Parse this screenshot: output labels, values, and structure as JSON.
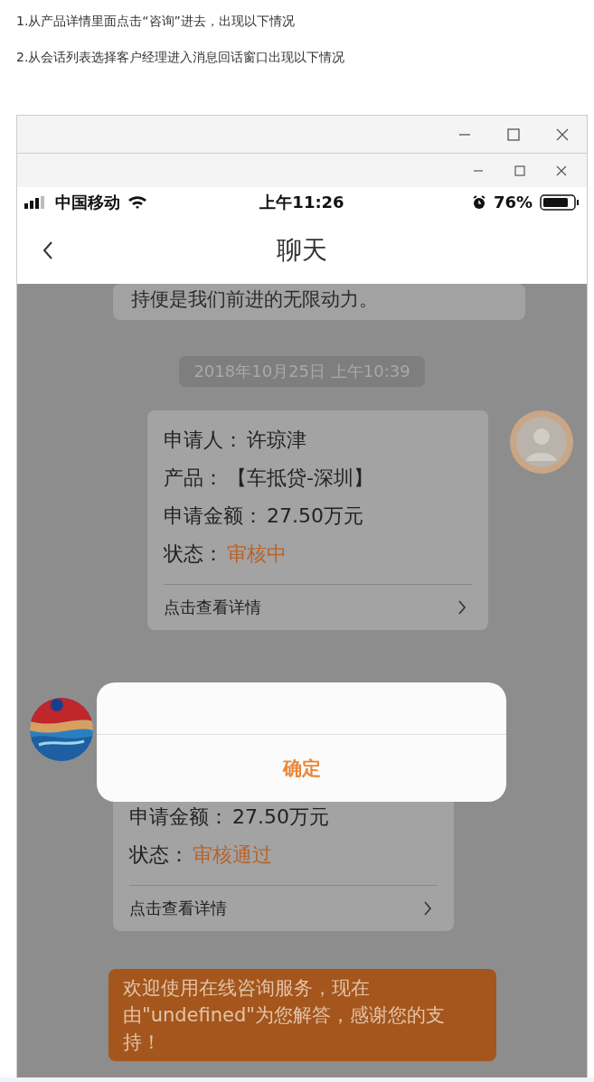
{
  "intro": [
    "1.从产品详情里面点击“咨询”进去，出现以下情况",
    "2.从会话列表选择客户经理进入消息回话窗口出现以下情况"
  ],
  "status_bar": {
    "carrier": "中国移动",
    "time": "上午11:26",
    "battery": "76%"
  },
  "nav": {
    "title": "聊天"
  },
  "messages": [
    {
      "kind": "note",
      "text": "持便是我们前进的无限动力。"
    },
    {
      "kind": "time",
      "text": "2018年10月25日 上午10:39"
    },
    {
      "kind": "sent",
      "rows": [
        {
          "label": "申请人：",
          "value": "许琼津",
          "kind": "plain"
        },
        {
          "label": "产品：",
          "value": "【车抵贷-深圳】",
          "kind": "plain"
        },
        {
          "label": "申请金额：",
          "value": "27.50万元",
          "kind": "plain"
        },
        {
          "label": "状态：",
          "value": "审核中",
          "kind": "status"
        }
      ],
      "link": "点击查看详情"
    },
    {
      "kind": "received",
      "rows": [
        {
          "label": "申请金额：",
          "value": "27.50万元",
          "kind": "plain"
        },
        {
          "label": "状态：",
          "value": "审核通过",
          "kind": "status"
        }
      ],
      "link": "点击查看详情"
    },
    {
      "kind": "bubble",
      "text": "欢迎使用在线咨询服务，现在由\"undefined\"为您解答，感谢您的支持！"
    }
  ],
  "dialog": {
    "button": "确定"
  }
}
